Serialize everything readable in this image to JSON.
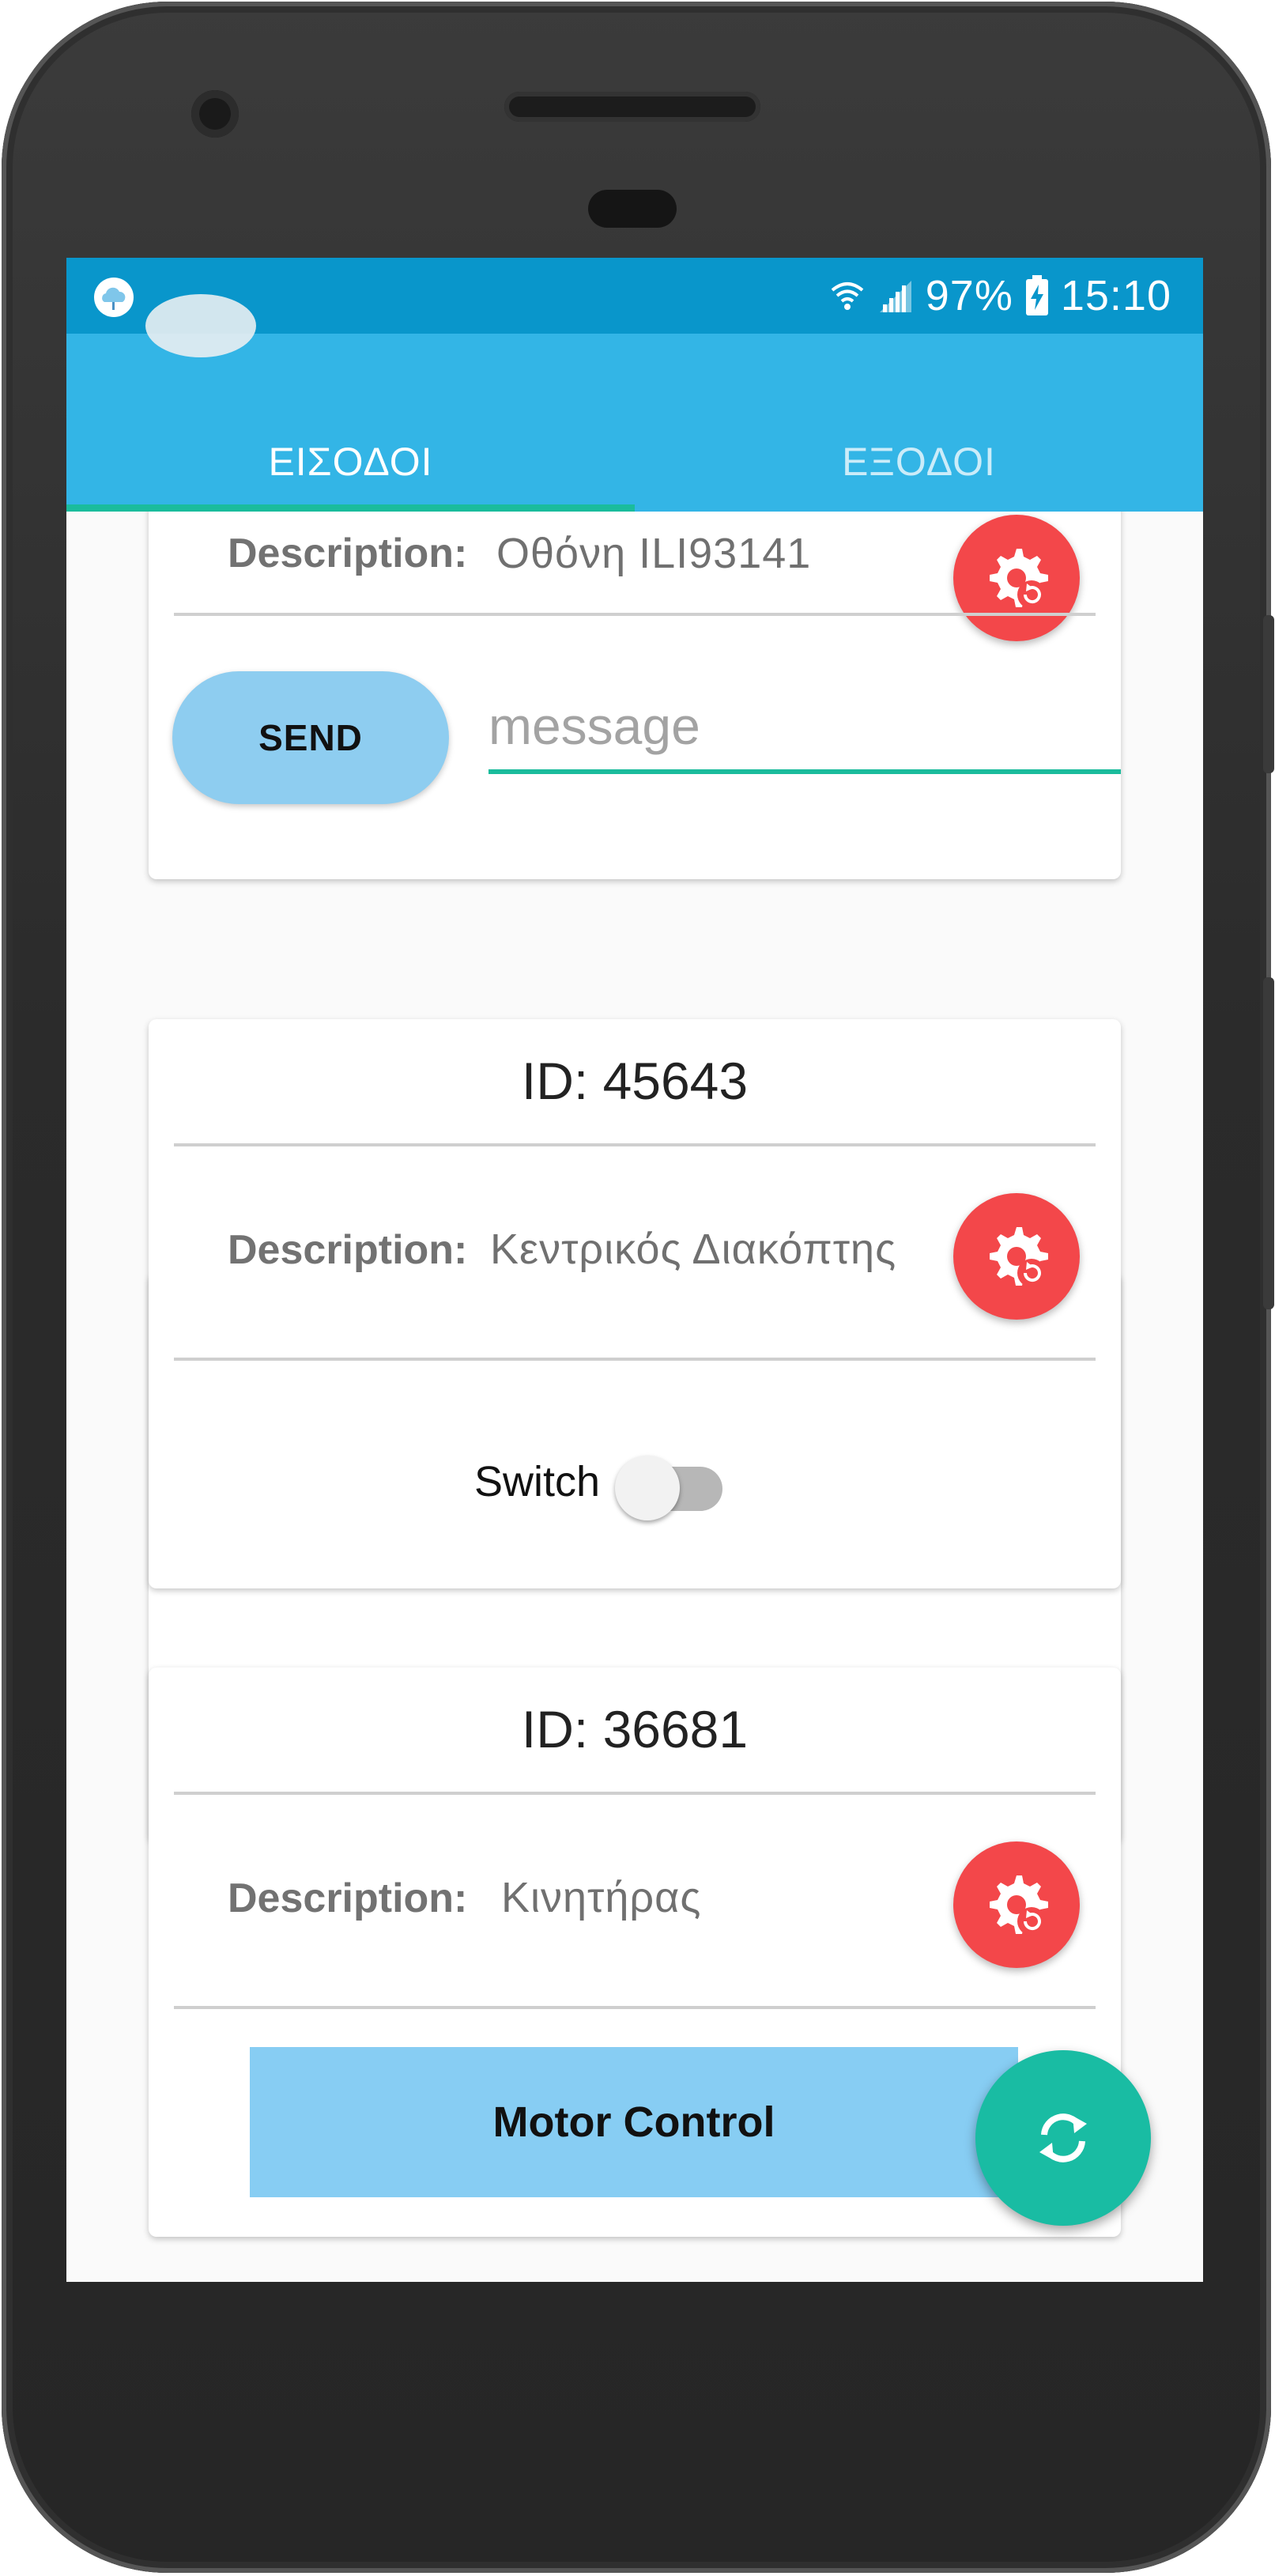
{
  "status_bar": {
    "battery_text": "97%",
    "time": "15:10",
    "left_icon": "cloud-icon",
    "icons": [
      "wifi-icon",
      "signal-icon",
      "battery-charging-icon"
    ]
  },
  "tabs": [
    {
      "label": "ΕΙΣΟΔΟΙ",
      "active": true
    },
    {
      "label": "ΕΞΟΔΟΙ",
      "active": false
    }
  ],
  "cards": [
    {
      "description_label": "Description:",
      "description_value": "Οθόνη ILI93141",
      "send_label": "SEND",
      "message_placeholder": "message"
    },
    {
      "id_text": "ID: 45643",
      "description_label": "Description:",
      "description_value": "Κεντρικός Διακόπτης",
      "switch_label": "Switch",
      "switch_on": false
    },
    {
      "id_text": "ID: 36681",
      "description_label": "Description:",
      "description_value": "Κινητήρας",
      "button_label": "Motor Control"
    }
  ],
  "fab_icon": "refresh-icon",
  "colors": {
    "status_bar": "#0996cb",
    "app_bar": "#33b5e6",
    "accent": "#1abc9c",
    "gear_button": "#f3474a",
    "send_button": "#8ecdf0",
    "fab": "#19bca3"
  }
}
